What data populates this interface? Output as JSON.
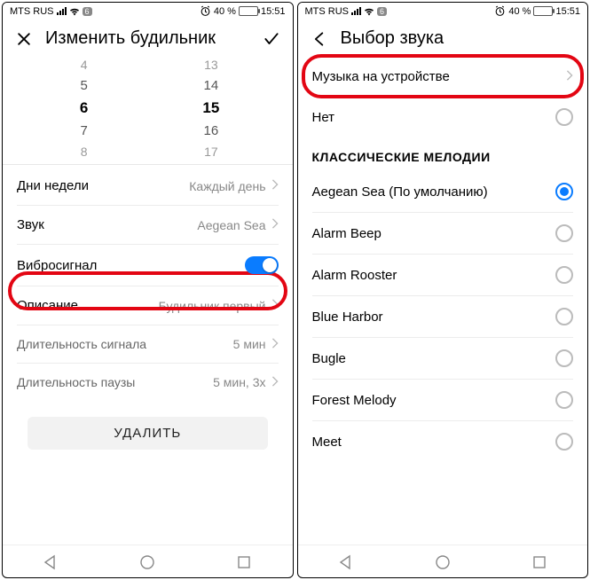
{
  "status": {
    "carrier": "MTS RUS",
    "notif_count": "6",
    "battery_pct": "40 %",
    "time": "15:51"
  },
  "left": {
    "title": "Изменить будильник",
    "picker": {
      "hours": [
        "4",
        "5",
        "6",
        "7",
        "8"
      ],
      "minutes": [
        "13",
        "14",
        "15",
        "16",
        "17"
      ]
    },
    "rows": {
      "days_label": "Дни недели",
      "days_value": "Каждый день",
      "sound_label": "Звук",
      "sound_value": "Aegean Sea",
      "vibrate_label": "Вибросигнал",
      "desc_label": "Описание",
      "desc_value": "Будильник первый",
      "signal_len_label": "Длительность сигнала",
      "signal_len_value": "5 мин",
      "pause_len_label": "Длительность паузы",
      "pause_len_value": "5 мин, 3x"
    },
    "delete_label": "УДАЛИТЬ"
  },
  "right": {
    "title": "Выбор звука",
    "music_label": "Музыка на устройстве",
    "none_label": "Нет",
    "section_title": "КЛАССИЧЕСКИЕ МЕЛОДИИ",
    "items": [
      "Aegean Sea (По умолчанию)",
      "Alarm Beep",
      "Alarm Rooster",
      "Blue Harbor",
      "Bugle",
      "Forest Melody",
      "Meet"
    ],
    "selected_index": 0
  }
}
